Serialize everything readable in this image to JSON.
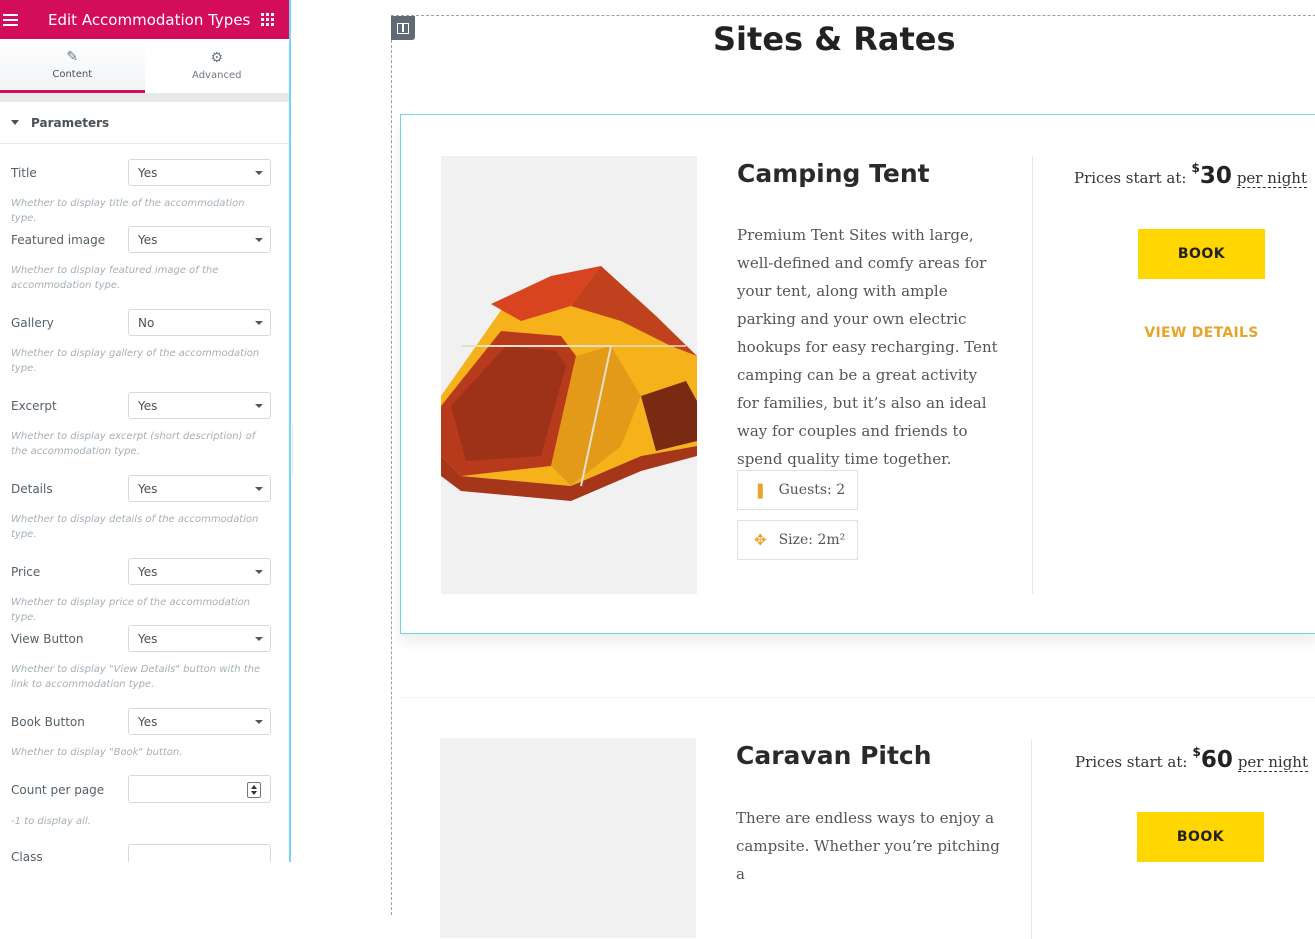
{
  "panel": {
    "title": "Edit Accommodation Types",
    "tabs": [
      {
        "label": "Content",
        "icon": "pencil-icon"
      },
      {
        "label": "Advanced",
        "icon": "gear-icon"
      }
    ],
    "section_title": "Parameters",
    "controls": [
      {
        "label": "Title",
        "value": "Yes",
        "desc": "Whether to display title of the accommodation type."
      },
      {
        "label": "Featured image",
        "value": "Yes",
        "desc": "Whether to display featured image of the accommodation type."
      },
      {
        "label": "Gallery",
        "value": "No",
        "desc": "Whether to display gallery of the accommodation type."
      },
      {
        "label": "Excerpt",
        "value": "Yes",
        "desc": "Whether to display excerpt (short description) of the accommodation type."
      },
      {
        "label": "Details",
        "value": "Yes",
        "desc": "Whether to display details of the accommodation type."
      },
      {
        "label": "Price",
        "value": "Yes",
        "desc": "Whether to display price of the accommodation type."
      },
      {
        "label": "View Button",
        "value": "Yes",
        "desc": "Whether to display \"View Details\" button with the link to accommodation type."
      },
      {
        "label": "Book Button",
        "value": "Yes",
        "desc": "Whether to display \"Book\" button."
      },
      {
        "label": "Count per page",
        "value": "",
        "desc": "-1 to display all."
      },
      {
        "label": "Class",
        "value": ""
      }
    ]
  },
  "preview": {
    "heading": "Sites & Rates",
    "accommodations": [
      {
        "name": "Camping Tent",
        "excerpt": "Premium Tent Sites with large, well-defined and comfy areas for your tent, along with ample parking and your own electric hookups for easy recharging. Tent camping can be a great activity for families, but it’s also an ideal way for couples and friends to spend quality time together.",
        "guests": "Guests: 2",
        "size": "Size: 2m²",
        "price_prefix": "Prices start at:",
        "currency": "$",
        "price": "30",
        "per": "per night",
        "book": "BOOK",
        "view": "VIEW DETAILS"
      },
      {
        "name": "Caravan Pitch",
        "excerpt": "There are endless ways to enjoy a campsite. Whether you’re pitching a",
        "price_prefix": "Prices start at:",
        "currency": "$",
        "price": "60",
        "per": "per night",
        "book": "BOOK"
      }
    ]
  },
  "colors": {
    "accent": "#d30c5c",
    "book_button": "#ffd600",
    "view_link": "#e6a42a",
    "tent_yellow": "#f6b21b",
    "tent_red": "#b83a1c"
  }
}
